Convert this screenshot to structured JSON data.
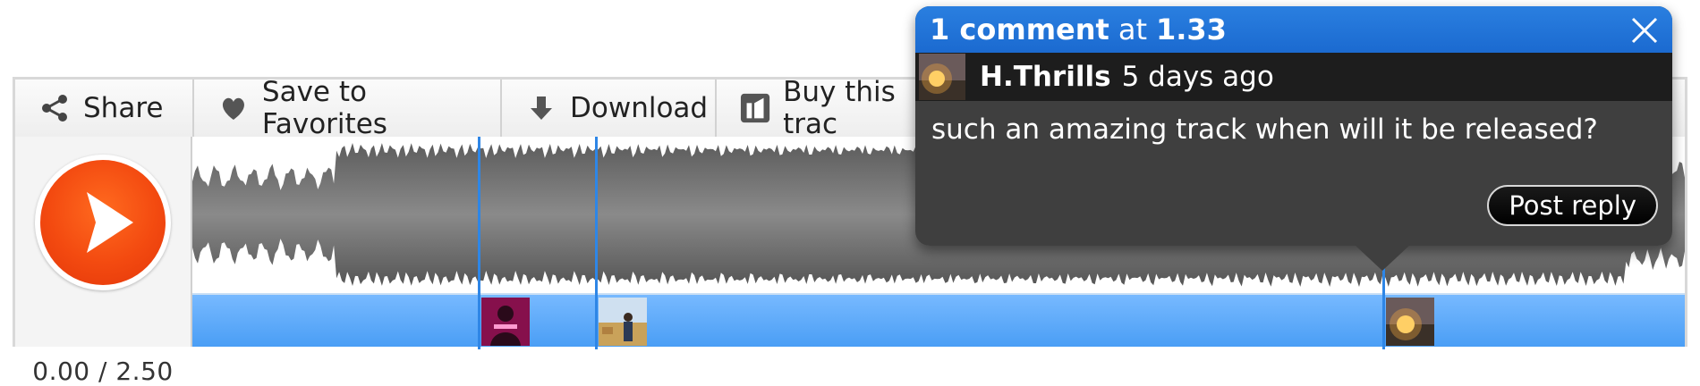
{
  "toolbar": {
    "share_label": "Share",
    "favorites_label": "Save to Favorites",
    "download_label": "Download",
    "buy_label": "Buy this trac"
  },
  "player": {
    "time_display": "0.00 / 2.50"
  },
  "comment_popup": {
    "count_label": "1 comment",
    "at_label": "at",
    "timestamp": "1.33",
    "user": "H.Thrills",
    "posted": "5 days ago",
    "text": "such an amazing track when will it be released?",
    "reply_label": "Post reply"
  },
  "colors": {
    "accent_blue": "#2a7fe0",
    "play_orange": "#f34a10",
    "strip_blue": "#5aa9f8",
    "popup_bg": "#3f3f3f"
  },
  "icons": [
    "share-icon",
    "heart-icon",
    "download-arrow-icon",
    "buy-icon",
    "play-icon",
    "close-icon"
  ]
}
